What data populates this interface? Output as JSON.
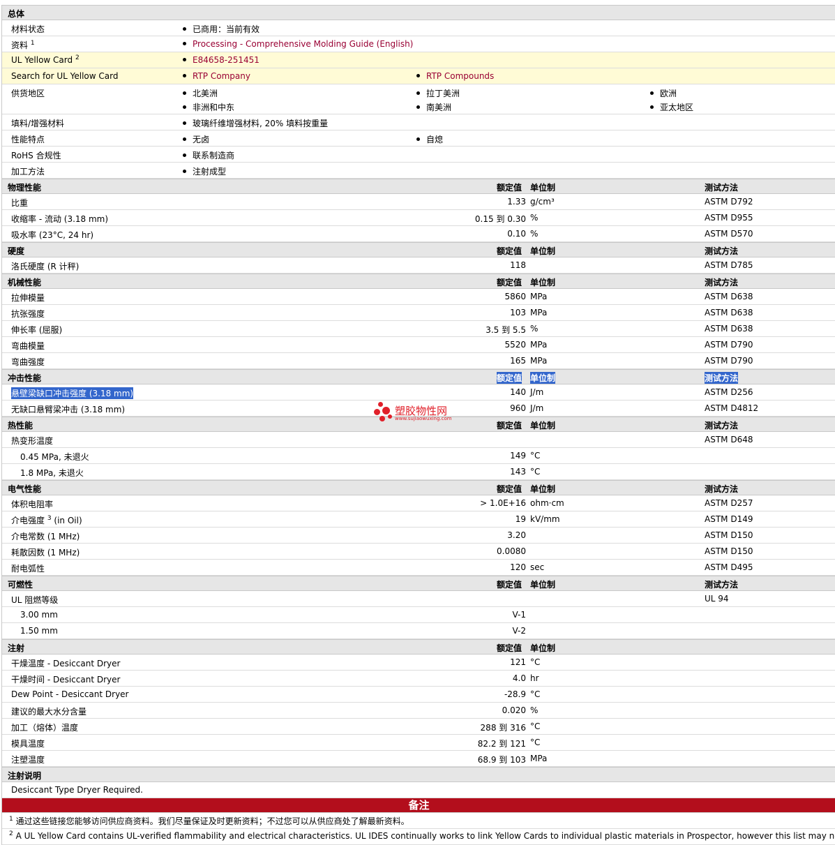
{
  "general": {
    "title": "总体",
    "status_label": "材料状态",
    "status_value": "已商用：当前有效",
    "docs_label": "资料",
    "docs_sup": "1",
    "docs_link": "Processing - Comprehensive Molding Guide (English)",
    "ul_label": "UL Yellow Card",
    "ul_sup": "2",
    "ul_link": "E84658-251451",
    "search_label": "Search for UL Yellow Card",
    "search_link1": "RTP Company",
    "search_link2": "RTP Compounds",
    "supply_label": "供货地区",
    "supply": [
      "北美洲",
      "拉丁美洲",
      "欧洲",
      "非洲和中东",
      "南美洲",
      "亚太地区"
    ],
    "filler_label": "填料/增强材料",
    "filler_value": "玻璃纤维增强材料, 20% 填料按重量",
    "features_label": "性能特点",
    "features": [
      "无卤",
      "自熄"
    ],
    "rohs_label": "RoHS 合规性",
    "rohs_value": "联系制造商",
    "process_label": "加工方法",
    "process_value": "注射成型"
  },
  "headers": {
    "value": "额定值",
    "unit": "单位制",
    "test": "测试方法"
  },
  "physical": {
    "title": "物理性能",
    "rows": [
      {
        "label": "比重",
        "value": "1.33",
        "unit": "g/cm³",
        "test": "ASTM D792"
      },
      {
        "label": "收缩率 - 流动 (3.18 mm)",
        "value": "0.15 到  0.30",
        "unit": "%",
        "test": "ASTM D955"
      },
      {
        "label": "吸水率 (23°C, 24 hr)",
        "value": "0.10",
        "unit": "%",
        "test": "ASTM D570"
      }
    ]
  },
  "hardness": {
    "title": "硬度",
    "rows": [
      {
        "label": "洛氏硬度 (R 计秤)",
        "value": "118",
        "unit": "",
        "test": "ASTM D785"
      }
    ]
  },
  "mechanical": {
    "title": "机械性能",
    "rows": [
      {
        "label": "拉伸模量",
        "value": "5860",
        "unit": "MPa",
        "test": "ASTM D638"
      },
      {
        "label": "抗张强度",
        "value": "103",
        "unit": "MPa",
        "test": "ASTM D638"
      },
      {
        "label": "伸长率 (屈服)",
        "value": "3.5 到  5.5",
        "unit": "%",
        "test": "ASTM D638"
      },
      {
        "label": "弯曲模量",
        "value": "5520",
        "unit": "MPa",
        "test": "ASTM D790"
      },
      {
        "label": "弯曲强度",
        "value": "165",
        "unit": "MPa",
        "test": "ASTM D790"
      }
    ]
  },
  "impact": {
    "title": "冲击性能",
    "rows": [
      {
        "label": "悬壁梁缺口冲击强度 (3.18 mm)",
        "value": "140",
        "unit": "J/m",
        "test": "ASTM D256"
      },
      {
        "label": "无缺口悬臂梁冲击 (3.18 mm)",
        "value": "960",
        "unit": "J/m",
        "test": "ASTM D4812"
      }
    ]
  },
  "thermal": {
    "title": "热性能",
    "rows": [
      {
        "label": "热变形温度",
        "value": "",
        "unit": "",
        "test": "ASTM D648"
      },
      {
        "label": "0.45 MPa, 未退火",
        "value": "149",
        "unit": "°C",
        "test": ""
      },
      {
        "label": "1.8 MPa, 未退火",
        "value": "143",
        "unit": "°C",
        "test": ""
      }
    ]
  },
  "electrical": {
    "title": "电气性能",
    "rows": [
      {
        "label": "体积电阻率",
        "value": "> 1.0E+16",
        "unit": "ohm·cm",
        "test": "ASTM D257"
      },
      {
        "label": "介电强度",
        "sup": "3",
        "suffix": " (in Oil)",
        "value": "19",
        "unit": "kV/mm",
        "test": "ASTM D149"
      },
      {
        "label": "介电常数 (1 MHz)",
        "value": "3.20",
        "unit": "",
        "test": "ASTM D150"
      },
      {
        "label": "耗散因数 (1 MHz)",
        "value": "0.0080",
        "unit": "",
        "test": "ASTM D150"
      },
      {
        "label": "耐电弧性",
        "value": "120",
        "unit": "sec",
        "test": "ASTM D495"
      }
    ]
  },
  "flammability": {
    "title": "可燃性",
    "rows": [
      {
        "label": "UL 阻燃等级",
        "value": "",
        "unit": "",
        "test": "UL 94"
      },
      {
        "label": "3.00 mm",
        "value": "V-1",
        "unit": "",
        "test": ""
      },
      {
        "label": "1.50 mm",
        "value": "V-2",
        "unit": "",
        "test": ""
      }
    ]
  },
  "injection": {
    "title": "注射",
    "rows": [
      {
        "label": "干燥温度 - Desiccant Dryer",
        "value": "121",
        "unit": "°C"
      },
      {
        "label": "干燥时间 - Desiccant Dryer",
        "value": "4.0",
        "unit": "hr"
      },
      {
        "label": "Dew Point - Desiccant Dryer",
        "value": "-28.9",
        "unit": "°C"
      },
      {
        "label": "建议的最大水分含量",
        "value": "0.020",
        "unit": "%"
      },
      {
        "label": "加工（熔体）温度",
        "value": "288 到  316",
        "unit": "°C"
      },
      {
        "label": "模具温度",
        "value": "82.2 到  121",
        "unit": "°C"
      },
      {
        "label": "注塑温度",
        "value": "68.9 到  103",
        "unit": "MPa"
      }
    ]
  },
  "injection_notes": {
    "title": "注射说明",
    "text": "Desiccant Type Dryer Required."
  },
  "notes": {
    "title": "备注",
    "note1_sup": "1",
    "note1": "通过这些链接您能够访问供应商资料。我们尽量保证及时更新资料；不过您可以从供应商处了解最新资料。",
    "note2_sup": "2",
    "note2": "A UL Yellow Card contains UL-verified flammability and electrical characteristics. UL IDES continually works to link Yellow Cards to individual plastic materials in Prospector, however this list may not inclu"
  },
  "watermark": {
    "title": "塑胶物性网",
    "url": "www.sujiaowuxing.com"
  }
}
